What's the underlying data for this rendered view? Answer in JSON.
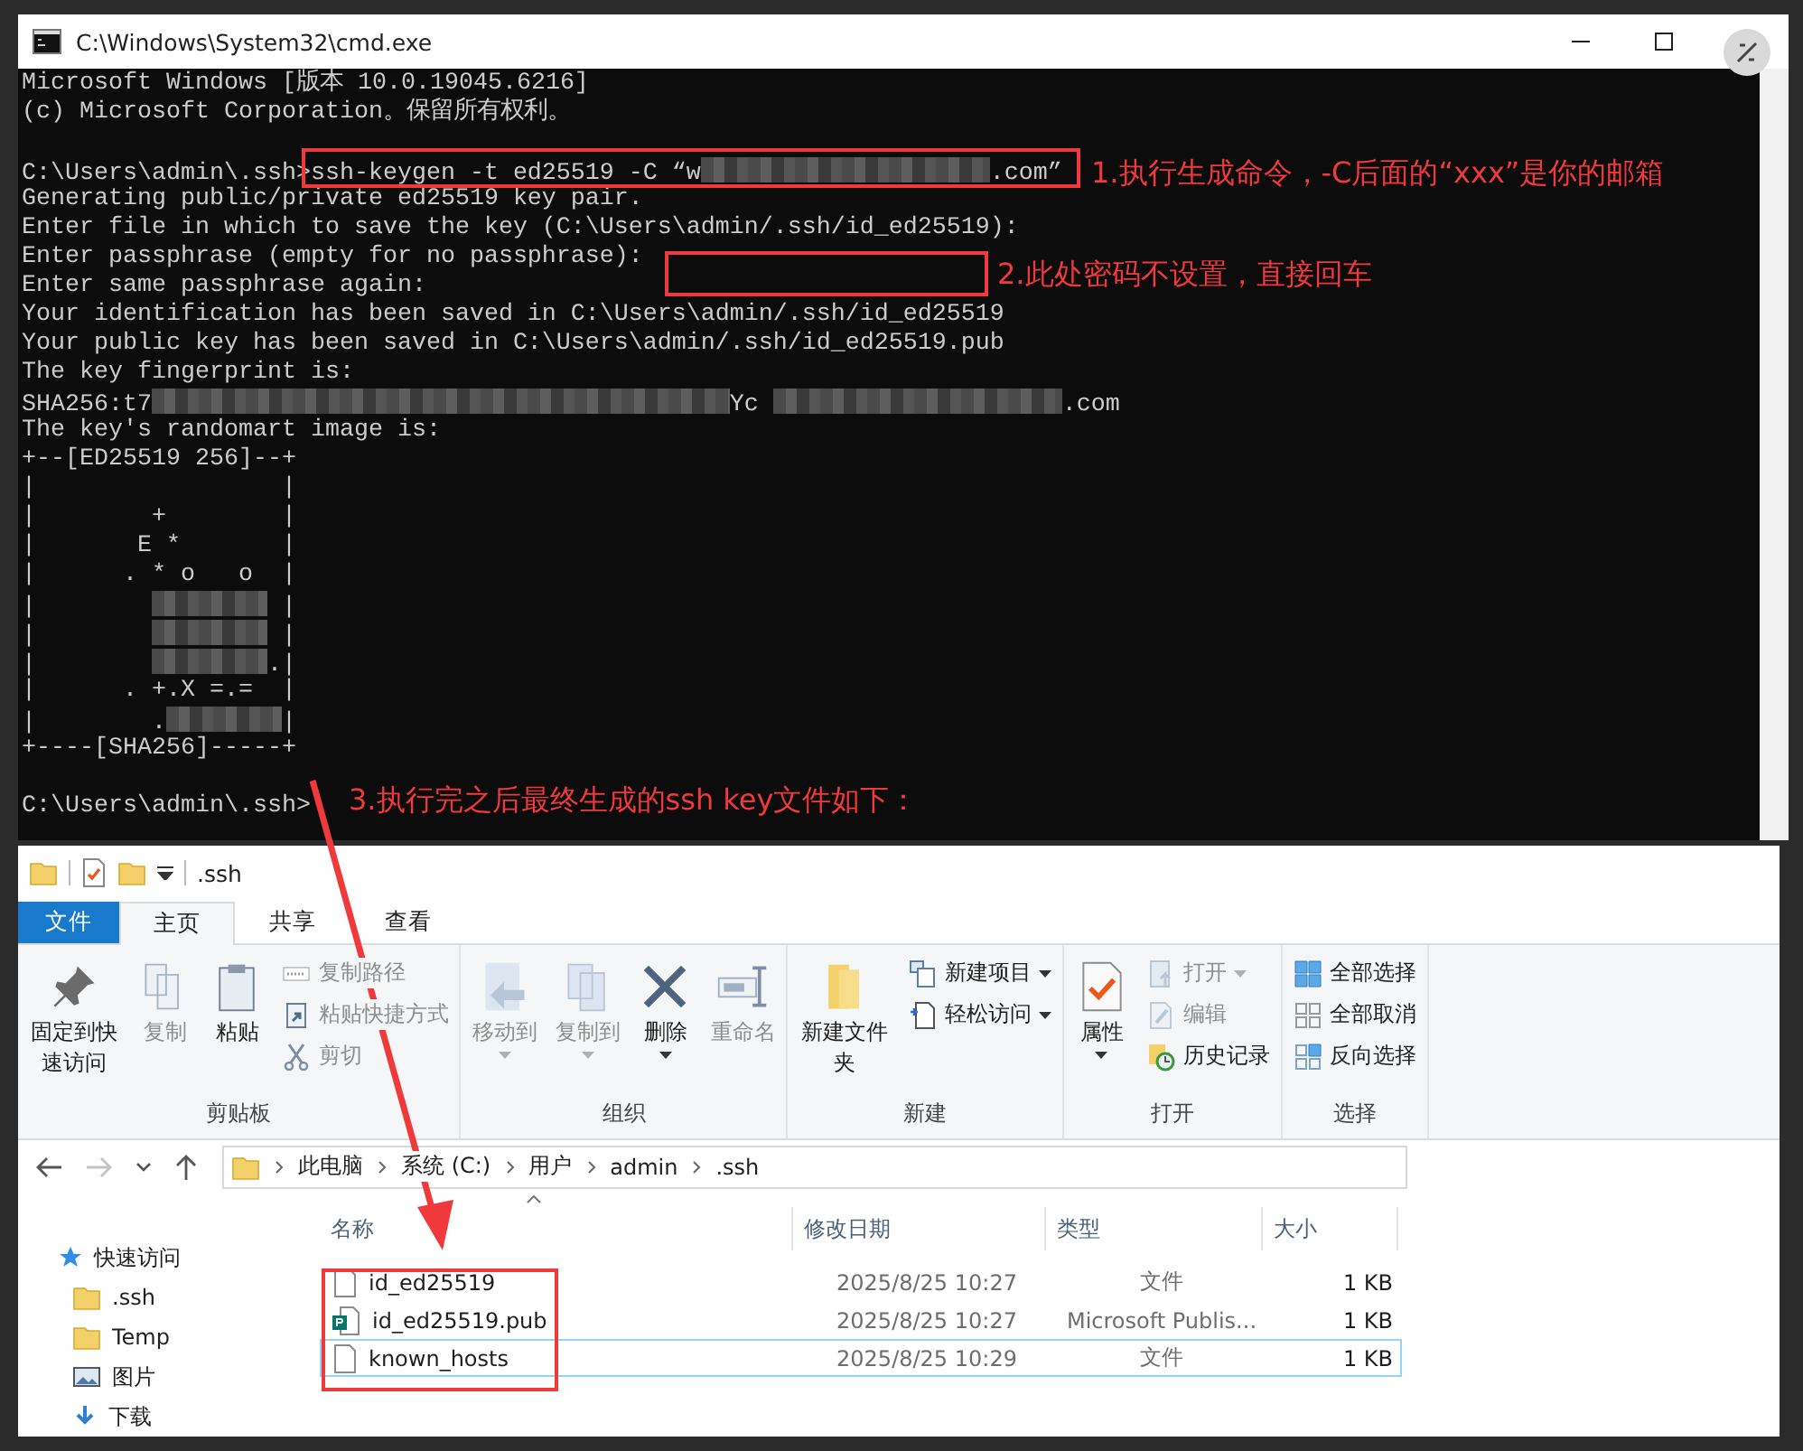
{
  "cmd_window": {
    "title": "C:\\Windows\\System32\\cmd.exe",
    "lines": [
      {
        "kind": "text",
        "text": "Microsoft Windows [版本 10.0.19045.6216]"
      },
      {
        "kind": "text",
        "text": "(c) Microsoft Corporation。保留所有权利。"
      },
      {
        "kind": "blank"
      },
      {
        "kind": "mixed",
        "segments": [
          {
            "kind": "text",
            "text": "C:\\Users\\admin\\.ssh>ssh-keygen -t ed25519 -C “w"
          },
          {
            "kind": "blur"
          },
          {
            "kind": "text",
            "text": ".com”"
          }
        ]
      },
      {
        "kind": "text",
        "text": "Generating public/private ed25519 key pair."
      },
      {
        "kind": "text",
        "text": "Enter file in which to save the key (C:\\Users\\admin/.ssh/id_ed25519):"
      },
      {
        "kind": "text",
        "text": "Enter passphrase (empty for no passphrase):"
      },
      {
        "kind": "text",
        "text": "Enter same passphrase again:"
      },
      {
        "kind": "text",
        "text": "Your identification has been saved in C:\\Users\\admin/.ssh/id_ed25519"
      },
      {
        "kind": "text",
        "text": "Your public key has been saved in C:\\Users\\admin/.ssh/id_ed25519.pub"
      },
      {
        "kind": "text",
        "text": "The key fingerprint is:"
      },
      {
        "kind": "mixed",
        "segments": [
          {
            "kind": "text",
            "text": "SHA256:t7"
          },
          {
            "kind": "blur"
          },
          {
            "kind": "text",
            "text": "Yc "
          },
          {
            "kind": "blur"
          },
          {
            "kind": "text",
            "text": ".com"
          }
        ]
      },
      {
        "kind": "text",
        "text": "The key's randomart image is:"
      },
      {
        "kind": "text",
        "text": "+--[ED25519 256]--+"
      },
      {
        "kind": "text",
        "text": "|                 |"
      },
      {
        "kind": "text",
        "text": "|        +        |"
      },
      {
        "kind": "text",
        "text": "|       E *       |"
      },
      {
        "kind": "text",
        "text": "|      . * o   o  |"
      },
      {
        "kind": "mixed",
        "segments": [
          {
            "kind": "text",
            "text": "|        "
          },
          {
            "kind": "blur"
          },
          {
            "kind": "text",
            "text": " |"
          }
        ]
      },
      {
        "kind": "mixed",
        "segments": [
          {
            "kind": "text",
            "text": "|        "
          },
          {
            "kind": "blur"
          },
          {
            "kind": "text",
            "text": " |"
          }
        ]
      },
      {
        "kind": "mixed",
        "segments": [
          {
            "kind": "text",
            "text": "|        "
          },
          {
            "kind": "blur"
          },
          {
            "kind": "text",
            "text": ".|"
          }
        ]
      },
      {
        "kind": "text",
        "text": "|      . +.X =.=  |"
      },
      {
        "kind": "mixed",
        "segments": [
          {
            "kind": "text",
            "text": "|        ."
          },
          {
            "kind": "blur"
          },
          {
            "kind": "text",
            "text": "|"
          }
        ]
      },
      {
        "kind": "text",
        "text": "+----[SHA256]-----+"
      },
      {
        "kind": "blank"
      },
      {
        "kind": "text",
        "text": "C:\\Users\\admin\\.ssh>"
      }
    ]
  },
  "annotations": [
    {
      "text": "1.执行生成命令，-C后面的“xxx”是你的邮箱"
    },
    {
      "text": "2.此处密码不设置，直接回车"
    },
    {
      "text": "3.执行完之后最终生成的ssh key文件如下："
    }
  ],
  "explorer": {
    "title": ".ssh",
    "tabs": [
      {
        "label": "文件",
        "kind": "file"
      },
      {
        "label": "主页",
        "selected": true,
        "kind": "tab"
      },
      {
        "label": "共享",
        "selected": false,
        "kind": "tab"
      },
      {
        "label": "查看",
        "selected": false,
        "kind": "tab"
      }
    ],
    "ribbon": [
      {
        "label": "剪贴板",
        "items": [
          {
            "kind": "large",
            "label": "固定到快速访问",
            "disabled": false,
            "dropdown": false
          },
          {
            "kind": "large",
            "label": "复制",
            "disabled": true,
            "dropdown": false
          },
          {
            "kind": "large",
            "label": "粘贴",
            "disabled": false,
            "dropdown": false
          },
          {
            "kind": "small",
            "label": "复制路径",
            "disabled": true,
            "dropdown": false
          },
          {
            "kind": "small",
            "label": "粘贴快捷方式",
            "disabled": true,
            "dropdown": false
          },
          {
            "kind": "small",
            "label": "剪切",
            "disabled": true,
            "dropdown": false
          }
        ]
      },
      {
        "label": "组织",
        "items": [
          {
            "kind": "large",
            "label": "移动到",
            "disabled": true,
            "dropdown": true
          },
          {
            "kind": "large",
            "label": "复制到",
            "disabled": true,
            "dropdown": true
          },
          {
            "kind": "large",
            "label": "删除",
            "disabled": false,
            "dropdown": true
          },
          {
            "kind": "large",
            "label": "重命名",
            "disabled": true,
            "dropdown": false
          }
        ]
      },
      {
        "label": "新建",
        "items": [
          {
            "kind": "large",
            "label": "新建文件夹",
            "disabled": false,
            "dropdown": false
          },
          {
            "kind": "small",
            "label": "新建项目",
            "disabled": false,
            "dropdown": true
          },
          {
            "kind": "small",
            "label": "轻松访问",
            "disabled": false,
            "dropdown": true
          }
        ]
      },
      {
        "label": "打开",
        "items": [
          {
            "kind": "large",
            "label": "属性",
            "disabled": false,
            "dropdown": true
          },
          {
            "kind": "small",
            "label": "打开",
            "disabled": true,
            "dropdown": true
          },
          {
            "kind": "small",
            "label": "编辑",
            "disabled": true,
            "dropdown": false
          },
          {
            "kind": "small",
            "label": "历史记录",
            "disabled": false,
            "dropdown": false
          }
        ]
      },
      {
        "label": "选择",
        "items": [
          {
            "kind": "small",
            "label": "全部选择",
            "disabled": false,
            "dropdown": false
          },
          {
            "kind": "small",
            "label": "全部取消",
            "disabled": false,
            "dropdown": false
          },
          {
            "kind": "small",
            "label": "反向选择",
            "disabled": false,
            "dropdown": false
          }
        ]
      }
    ],
    "nav_buttons": [
      {
        "kind": "back",
        "disabled": false
      },
      {
        "kind": "forward",
        "disabled": true
      },
      {
        "kind": "recent",
        "disabled": false
      },
      {
        "kind": "up",
        "disabled": false
      }
    ],
    "breadcrumb": [
      "此电脑",
      "系统 (C:)",
      "用户",
      "admin",
      ".ssh"
    ],
    "sidebar": {
      "items": [
        {
          "label": "快速访问",
          "kind": "star",
          "children": [
            {
              "label": ".ssh",
              "kind": "folder"
            },
            {
              "label": "Temp",
              "kind": "folder"
            },
            {
              "label": "图片",
              "kind": "pictures"
            },
            {
              "label": "下载",
              "kind": "download"
            }
          ]
        }
      ]
    },
    "table": {
      "columns": [
        "名称",
        "修改日期",
        "类型",
        "大小"
      ],
      "rows": [
        {
          "kind": "file",
          "focused": false,
          "cells": [
            "id_ed25519",
            "2025/8/25 10:27",
            "文件",
            "1 KB"
          ]
        },
        {
          "kind": "publisher",
          "focused": false,
          "cells": [
            "id_ed25519.pub",
            "2025/8/25 10:27",
            "Microsoft Publis...",
            "1 KB"
          ]
        },
        {
          "kind": "file",
          "focused": true,
          "cells": [
            "known_hosts",
            "2025/8/25 10:29",
            "文件",
            "1 KB"
          ]
        }
      ]
    }
  }
}
